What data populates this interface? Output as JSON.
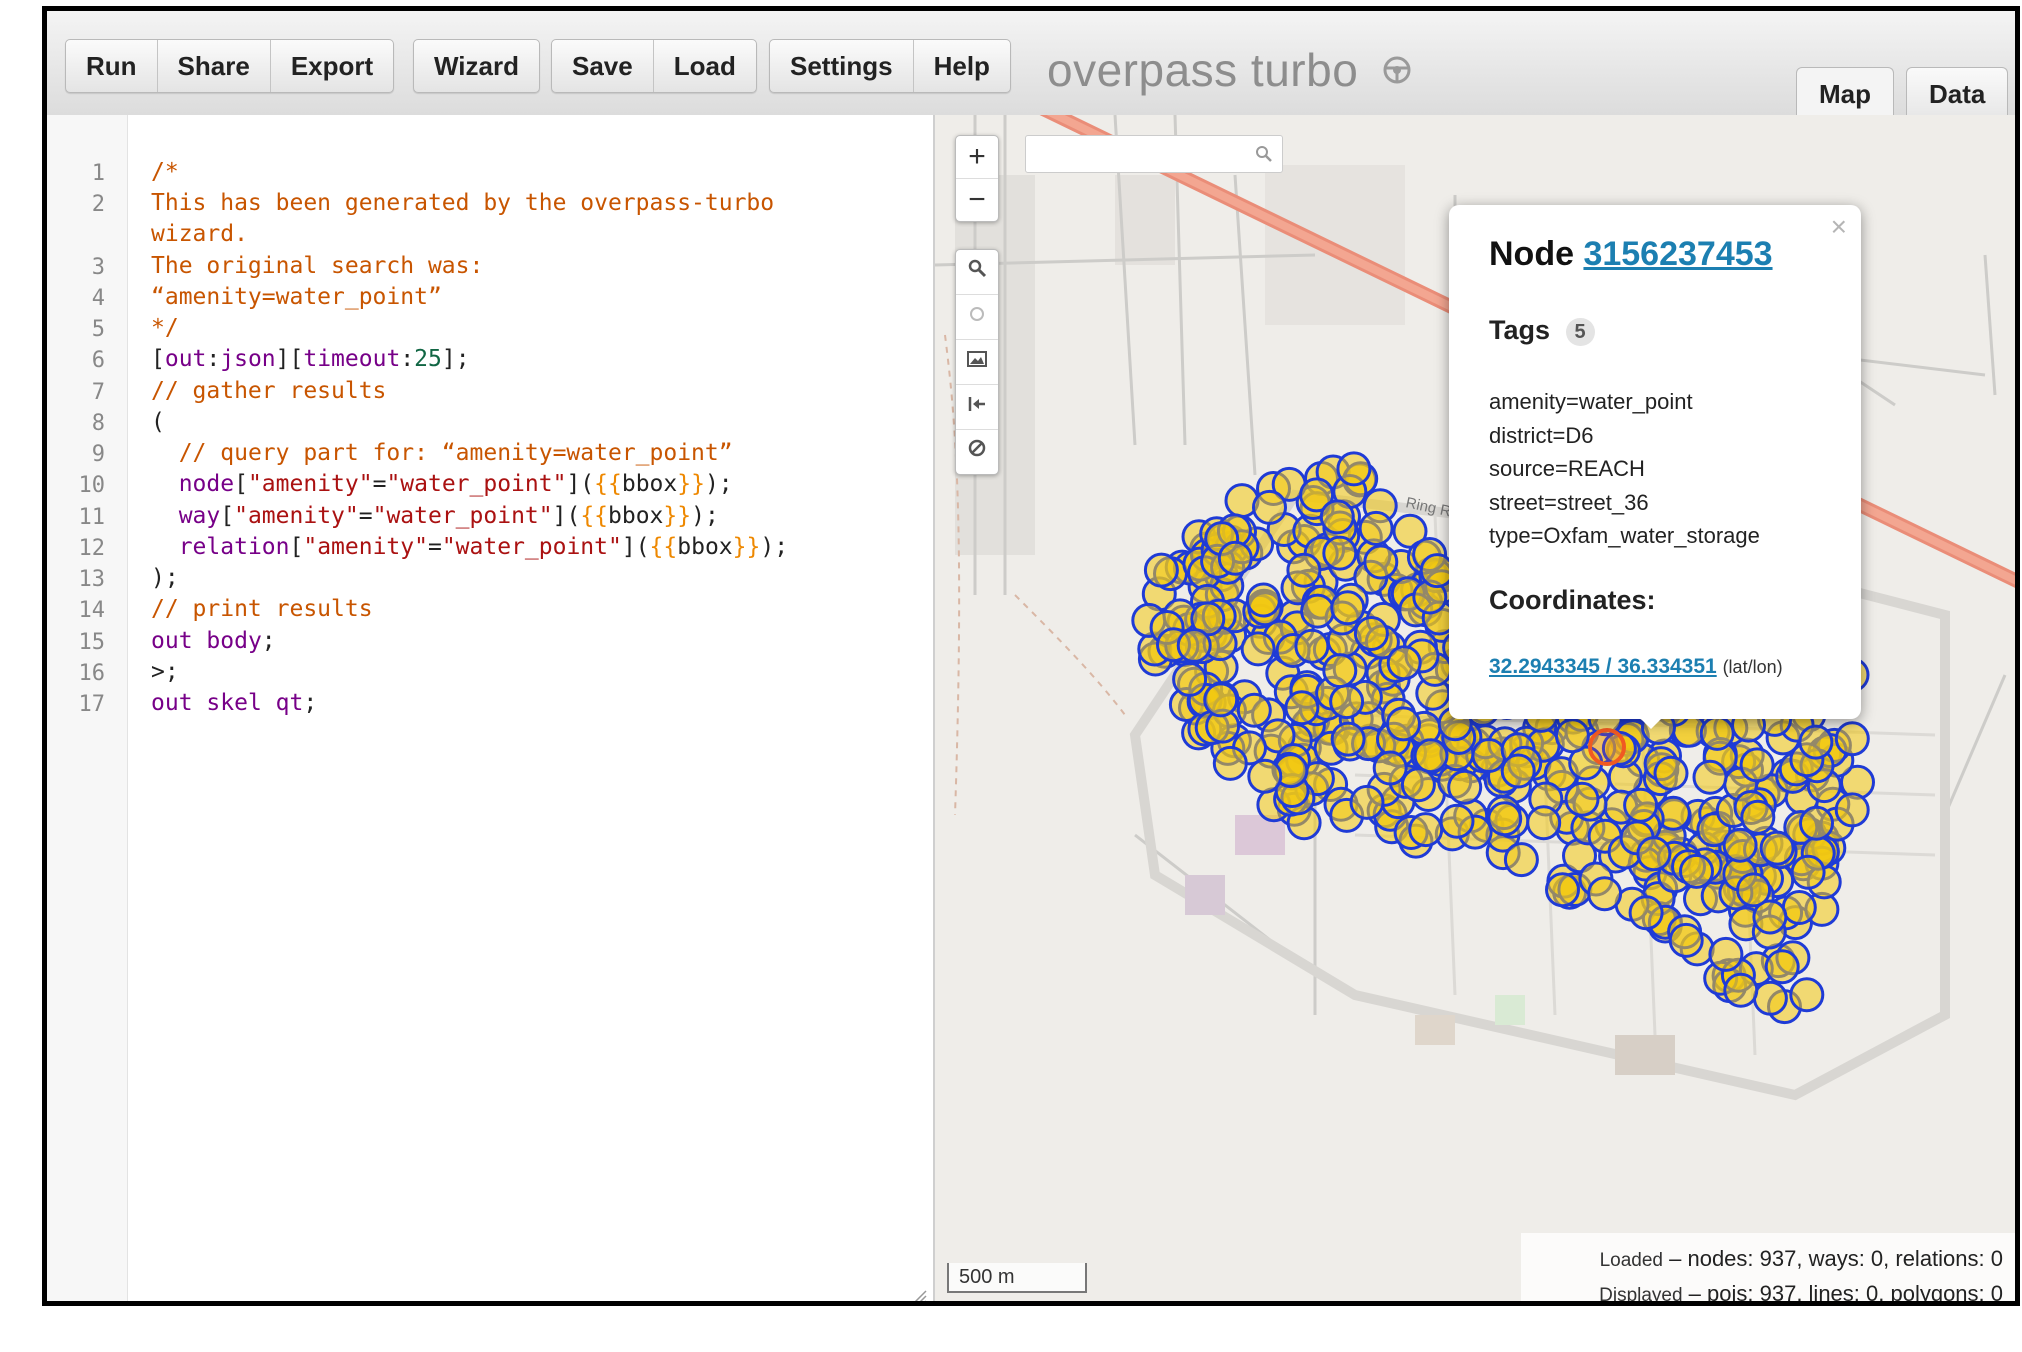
{
  "toolbar": {
    "group1": [
      "Run",
      "Share",
      "Export"
    ],
    "group2": [
      "Wizard"
    ],
    "group3": [
      "Save",
      "Load"
    ],
    "group4": [
      "Settings",
      "Help"
    ],
    "brand": "overpass turbo"
  },
  "tabs": {
    "map": "Map",
    "data": "Data"
  },
  "editor": {
    "line_numbers": [
      "1",
      "2",
      "",
      "3",
      "4",
      "5",
      "6",
      "7",
      "8",
      "9",
      "10",
      "11",
      "12",
      "13",
      "14",
      "15",
      "16",
      "17"
    ]
  },
  "map": {
    "zoom_in": "+",
    "zoom_out": "−",
    "scale_label": "500 m",
    "road_label": "Ring Road",
    "colors": {
      "marker_fill": "#f2c811",
      "marker_stroke": "#1f3bd6",
      "selected_stroke": "#f05a22",
      "road": "#ea8d78"
    }
  },
  "popup": {
    "title_prefix": "Node",
    "node_id": "3156237453",
    "tags_label": "Tags",
    "tags_count": "5",
    "tags": [
      "amenity=water_point",
      "district=D6",
      "source=REACH",
      "street=street_36",
      "type=Oxfam_water_storage"
    ],
    "coords_label": "Coordinates:",
    "coords": "32.2943345 / 36.334351",
    "coords_unit": "(lat/lon)",
    "close": "×"
  },
  "stats": {
    "loaded_label": "Loaded",
    "loaded_value": "nodes: 937, ways: 0, relations: 0",
    "displayed_label": "Displayed",
    "displayed_value": "pois: 937, lines: 0, polygons: 0"
  }
}
